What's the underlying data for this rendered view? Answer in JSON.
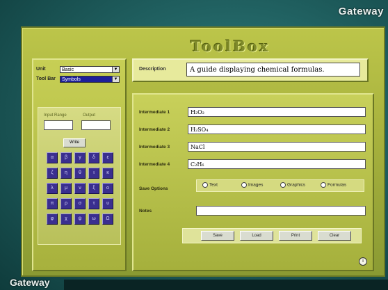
{
  "branding": {
    "top": "Gateway",
    "bottom": "Gateway"
  },
  "window": {
    "title": "ToolBox"
  },
  "left_panel": {
    "row1_label": "Unit",
    "row1_value": "Basic",
    "row2_label": "Tool Bar",
    "row2_value": "Symbols",
    "keypad": {
      "label_left": "Input Range",
      "label_right": "Output",
      "mid_button": "Write",
      "keys": [
        "α",
        "β",
        "γ",
        "δ",
        "ε",
        "ζ",
        "η",
        "θ",
        "ι",
        "κ",
        "λ",
        "μ",
        "ν",
        "ξ",
        "ο",
        "π",
        "ρ",
        "σ",
        "τ",
        "υ",
        "φ",
        "χ",
        "ψ",
        "ω",
        "Ω"
      ]
    }
  },
  "description": {
    "label": "Description",
    "value": "A guide displaying chemical formulas."
  },
  "fields": [
    {
      "label": "Intermediate 1",
      "value": "H₂O₂"
    },
    {
      "label": "Intermediate 2",
      "value": "H₂SO₄"
    },
    {
      "label": "Intermediate 3",
      "value": "NaCl"
    },
    {
      "label": "Intermediate 4",
      "value": "C₂H₆"
    }
  ],
  "radio": {
    "label": "Save Options",
    "options": [
      "Text",
      "Images",
      "Graphics",
      "Formulas"
    ]
  },
  "notes": {
    "label": "Notes",
    "value": ""
  },
  "buttons": {
    "save": "Save",
    "load": "Load",
    "print": "Print",
    "clear": "Clear"
  }
}
